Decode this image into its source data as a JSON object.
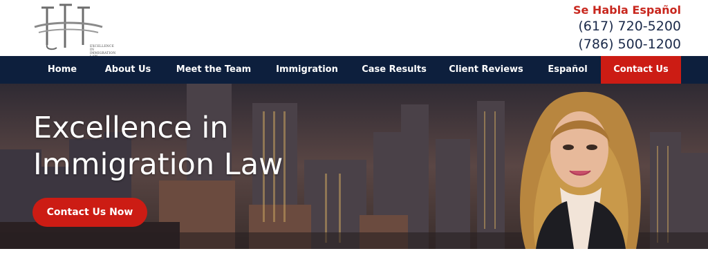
{
  "header": {
    "logo_name": "logo-icon",
    "logo_tagline_1": "EXCELLENCE IN",
    "logo_tagline_2": "IMMIGRATION LAW",
    "spanish_notice": "Se Habla Español",
    "phone_1": "(617) 720-5200",
    "phone_2": "(786) 500-1200"
  },
  "nav": {
    "items": [
      {
        "label": "Home"
      },
      {
        "label": "About Us"
      },
      {
        "label": "Meet the Team"
      },
      {
        "label": "Immigration"
      },
      {
        "label": "Case Results"
      },
      {
        "label": "Client Reviews"
      },
      {
        "label": "Español"
      },
      {
        "label": "Contact Us"
      }
    ]
  },
  "hero": {
    "title_line_1": "Excellence in",
    "title_line_2": "Immigration Law",
    "cta_label": "Contact Us Now"
  },
  "colors": {
    "brand_red": "#cc1c14",
    "nav_bg": "#0d1f3d",
    "phone_text": "#1b2a4a"
  }
}
